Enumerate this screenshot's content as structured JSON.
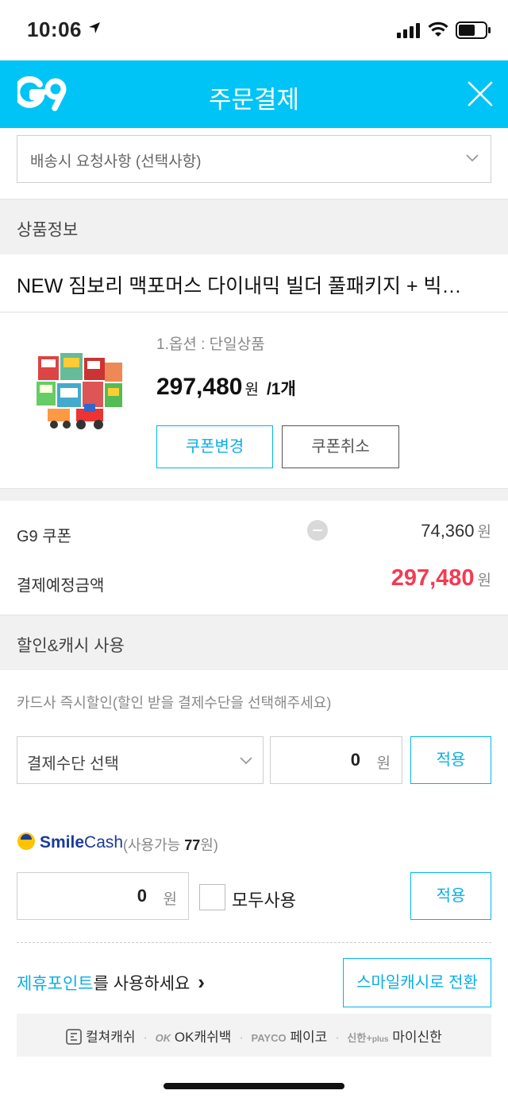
{
  "status_bar": {
    "time": "10:06"
  },
  "header": {
    "logo": "G9",
    "title": "주문결제",
    "close_icon": "close-icon"
  },
  "delivery_request": {
    "placeholder": "배송시 요청사항 (선택사항)"
  },
  "product_section": {
    "title": "상품정보",
    "product_name": "NEW 짐보리 맥포머스 다이내믹 빌더 풀패키지 + 빅…",
    "option": "1.옵션 : 단일상품",
    "price": "297,480",
    "price_unit": "원",
    "quantity": "/1개",
    "coupon_change": "쿠폰변경",
    "coupon_cancel": "쿠폰취소"
  },
  "summary": {
    "coupon_label": "G9 쿠폰",
    "coupon_value": "74,360",
    "coupon_unit": "원",
    "total_label": "결제예정금액",
    "total_value": "297,480",
    "total_unit": "원"
  },
  "discount_section": {
    "title": "할인&캐시 사용",
    "card_hint": "카드사 즉시할인(할인 받을 결제수단을 선택해주세요)",
    "payment_select": "결제수단 선택",
    "card_amount": "0",
    "card_unit": "원",
    "apply": "적용"
  },
  "smile_cash": {
    "brand_smile": "Smile",
    "brand_cash": "Cash",
    "available_prefix": "(사용가능",
    "available_amount": "77",
    "available_suffix": "원)",
    "amount": "0",
    "unit": "원",
    "use_all": "모두사용",
    "apply": "적용"
  },
  "partner": {
    "highlight": "제휴포인트",
    "rest": "를 사용하세요",
    "arrow": "›",
    "convert_button": "스마일캐시로 전환",
    "culture_cash": "컬쳐캐쉬",
    "ok_logo": "OK",
    "ok_cashbag": "OK캐쉬백",
    "payco_logo": "PAYCO",
    "payco": "페이코",
    "shinhan_logo": "신한",
    "shinhan_plus": "plus",
    "my_shinhan": "마이신한"
  },
  "colors": {
    "brand": "#00c4f5",
    "accent_blue": "#0aaee8",
    "price_red": "#f53a52"
  }
}
